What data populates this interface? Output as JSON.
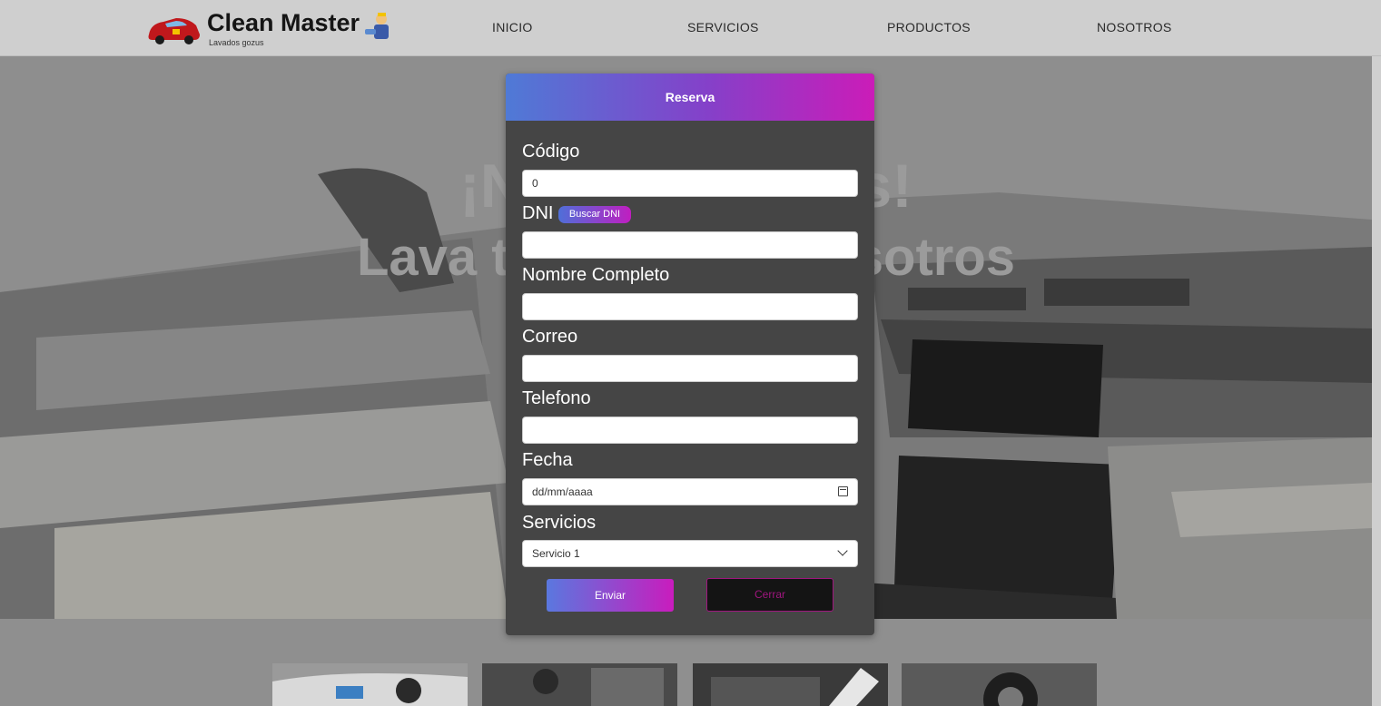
{
  "brand": {
    "name": "Clean Master",
    "tagline": "Lavados gozus"
  },
  "nav": [
    {
      "label": "INICIO"
    },
    {
      "label": "SERVICIOS"
    },
    {
      "label": "PRODUCTOS"
    },
    {
      "label": "NOSOTROS"
    }
  ],
  "hero": {
    "line1": "¡Nosotros más!",
    "line2": "Lava tu auto con nosotros"
  },
  "modal": {
    "title": "Reserva",
    "codigo": {
      "label": "Código",
      "value": "0"
    },
    "dni": {
      "label": "DNI",
      "button": "Buscar DNI",
      "value": ""
    },
    "nombre": {
      "label": "Nombre Completo",
      "value": ""
    },
    "correo": {
      "label": "Correo",
      "value": ""
    },
    "telefono": {
      "label": "Telefono",
      "value": ""
    },
    "fecha": {
      "label": "Fecha",
      "placeholder": "dd/mm/aaaa"
    },
    "servicios": {
      "label": "Servicios",
      "selected": "Servicio 1"
    },
    "submit": "Enviar",
    "close": "Cerrar"
  },
  "colors": {
    "accent_start": "#4f7ad6",
    "accent_end": "#cb1cb8",
    "modal_bg": "#454545",
    "close_border": "#a0167f"
  },
  "icons": [
    "car-logo-icon",
    "mascot-icon",
    "calendar-icon",
    "chevron-down-icon"
  ]
}
